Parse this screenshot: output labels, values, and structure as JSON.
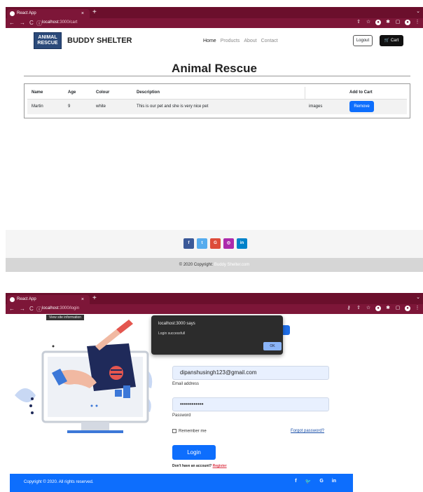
{
  "cart_screen": {
    "browser": {
      "tab_title": "React App",
      "tab_close": "×",
      "new_tab": "+",
      "url_host": "localhost",
      "url_path": ":3000/cart"
    },
    "navbar": {
      "logo_line1": "ANIMAL",
      "logo_line2": "RESCUE",
      "brand_name": "BUDDY SHELTER",
      "menu": [
        "Home",
        "Products",
        "About",
        "Contact"
      ],
      "logout_label": "Logout",
      "cart_label": "Cart"
    },
    "page_title": "Animal Rescue",
    "table": {
      "headers": [
        "Name",
        "Age",
        "Colour",
        "Description",
        "",
        "Add to Cart"
      ],
      "rows": [
        {
          "name": "Martin",
          "age": "9",
          "colour": "white",
          "description": "This is our pet and she is very nice pet",
          "images": "images",
          "action": "Remove"
        }
      ]
    },
    "social": [
      {
        "icon": "facebook-icon",
        "glyph": "f",
        "color": "#3b5998"
      },
      {
        "icon": "twitter-icon",
        "glyph": "t",
        "color": "#55acee"
      },
      {
        "icon": "google-icon",
        "glyph": "G",
        "color": "#dd4b39"
      },
      {
        "icon": "instagram-icon",
        "glyph": "◎",
        "color": "#ac2bac"
      },
      {
        "icon": "linkedin-icon",
        "glyph": "in",
        "color": "#0082ca"
      }
    ],
    "copyright_text": "© 2020 Copyright:",
    "copyright_link": "Buddy Shelter.com"
  },
  "login_screen": {
    "browser": {
      "tab_title": "React App",
      "tab_close": "×",
      "new_tab": "+",
      "url_host": "localhost",
      "url_path": ":3000/login",
      "tooltip": "View site information"
    },
    "dialog": {
      "title": "localhost:3000 says",
      "message": "Login successfull",
      "ok_label": "OK"
    },
    "email_value": "dipanshusingh123@gmail.com",
    "email_label": "Email address",
    "password_value": "••••••••••••",
    "password_label": "Password",
    "remember_label": "Remember me",
    "forgot_label": "Forgot password?",
    "login_label": "Login",
    "no_account_text": "Don't have an account?",
    "register_label": "Register",
    "footer_copyright": "Copyright © 2020. All rights reserved.",
    "footer_icons": [
      "f",
      "🐦",
      "G",
      "in"
    ]
  },
  "colors": {
    "browser_frame": "#7d1638",
    "primary": "#0d6efd",
    "dialog_bg": "#2c2c2c"
  }
}
